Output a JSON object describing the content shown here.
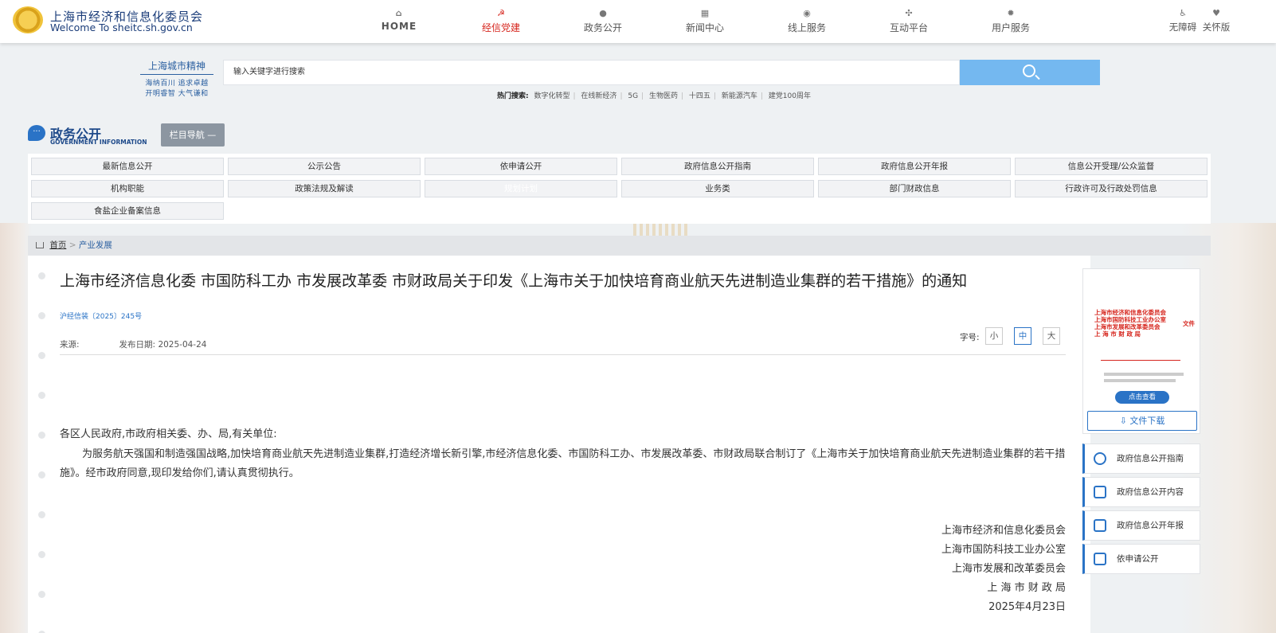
{
  "site": {
    "title": "上海市经济和信息化委员会",
    "subtitle": "Welcome To sheitc.sh.gov.cn"
  },
  "nav": [
    {
      "label": "HOME",
      "icon": "home-icon",
      "active": false
    },
    {
      "label": "经信党建",
      "icon": "party-icon",
      "active": true
    },
    {
      "label": "政务公开",
      "icon": "chat-icon",
      "active": false
    },
    {
      "label": "新闻中心",
      "icon": "news-icon",
      "active": false
    },
    {
      "label": "线上服务",
      "icon": "user-service-icon",
      "active": false
    },
    {
      "label": "互动平台",
      "icon": "interact-icon",
      "active": false
    },
    {
      "label": "用户服务",
      "icon": "gear-icon",
      "active": false
    }
  ],
  "accessibility": {
    "barrier_free": "无障碍",
    "care": "关怀版"
  },
  "spirit": {
    "title": "上海城市精神",
    "line1": "海纳百川 追求卓越",
    "line2": "开明睿智 大气谦和"
  },
  "search": {
    "placeholder": "输入关键字进行搜索"
  },
  "hot_search": {
    "label": "热门搜索:",
    "terms": [
      "数字化转型",
      "在线新经济",
      "5G",
      "生物医药",
      "十四五",
      "新能源汽车",
      "建党100周年"
    ]
  },
  "section": {
    "title": "政务公开",
    "subtitle": "GOVERNMENT INFORMATION",
    "column_nav": "栏目导航 —"
  },
  "menu": [
    [
      "最新信息公开",
      "公示公告",
      "依申请公开",
      "政府信息公开指南",
      "政府信息公开年报",
      "信息公开受理/公众监督"
    ],
    [
      "机构职能",
      "政策法规及解读",
      "规划计划",
      "业务类",
      "部门财政信息",
      "行政许可及行政处罚信息"
    ],
    [
      "食盐企业备案信息"
    ]
  ],
  "breadcrumb": {
    "home": "首页",
    "sep": ">",
    "current": "产业发展"
  },
  "article": {
    "title": "上海市经济信息化委 市国防科工办 市发展改革委 市财政局关于印发《上海市关于加快培育商业航天先进制造业集群的若干措施》的通知",
    "doc_no": "沪经信装〔2025〕245号",
    "source_label": "来源:",
    "date_label": "发布日期:",
    "date": "2025-04-24",
    "font_size_label": "字号:",
    "font_sizes": [
      "小",
      "中",
      "大"
    ],
    "salutation": "各区人民政府,市政府相关委、办、局,有关单位:",
    "paragraph": "为服务航天强国和制造强国战略,加快培育商业航天先进制造业集群,打造经济增长新引擎,市经济信息化委、市国防科工办、市发展改革委、市财政局联合制订了《上海市关于加快培育商业航天先进制造业集群的若干措施》。经市政府同意,现印发给你们,请认真贯彻执行。",
    "signatures": [
      "上海市经济和信息化委员会",
      "上海市国防科技工业办公室",
      "上海市发展和改革委员会",
      "上 海 市 财 政 局"
    ],
    "sign_date": "2025年4月23日"
  },
  "sidebar": {
    "thumb_lines": [
      "上海市经济和信息化委员会",
      "上海市国防科技工业办公室",
      "上海市发展和改革委员会",
      "上 海 市 财 政 局"
    ],
    "thumb_suffix": "文件",
    "view_button": "点击查看",
    "download_button": "文件下载",
    "links": [
      {
        "label": "政府信息公开指南",
        "icon": "compass-icon"
      },
      {
        "label": "政府信息公开内容",
        "icon": "list-icon"
      },
      {
        "label": "政府信息公开年报",
        "icon": "report-icon"
      },
      {
        "label": "依申请公开",
        "icon": "apply-icon"
      }
    ]
  }
}
